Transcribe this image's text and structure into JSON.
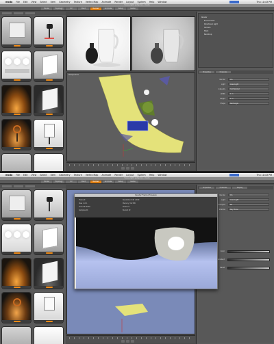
{
  "menubar": {
    "app": "modo",
    "menus": [
      "File",
      "Edit",
      "View",
      "Select",
      "Item",
      "Geometry",
      "Texture",
      "Vertex Map",
      "Animate",
      "Render",
      "Layout",
      "System",
      "Help",
      "Window"
    ],
    "clock": "Thu 10:43 PM"
  },
  "window_title": "Scene light setup.lxo - modo",
  "toolbar_tabs": [
    "Model",
    "Topology",
    "UV",
    "Paint",
    "Render",
    "Animate",
    "Setup",
    "Game"
  ],
  "active_tab_index": 4,
  "presets_panel": {
    "items": [
      {
        "icon": "studio-light-icon"
      },
      {
        "icon": "spotlight-stand-icon"
      },
      {
        "icon": "light-bulbs-icon"
      },
      {
        "icon": "softbox-icon"
      },
      {
        "icon": "amber-glow-icon"
      },
      {
        "icon": "softbox-icon"
      },
      {
        "icon": "lamp-fire-icon"
      },
      {
        "icon": "softbox-stand-icon"
      },
      {
        "icon": "grey-backdrop-icon"
      },
      {
        "icon": "white-backdrop-icon"
      }
    ]
  },
  "viewports": {
    "render_left_label": "Render",
    "render_right_label": "Preview",
    "perspective_label": "Perspective"
  },
  "item_tree": {
    "rows": [
      "Render",
      "Environment",
      "Directional Light",
      "Camera",
      "Mesh",
      "Backdrop",
      "Area Light",
      "Spot Light"
    ]
  },
  "properties": {
    "tabs": [
      "Properties",
      "Channels",
      "Display"
    ],
    "fields": [
      {
        "label": "Render",
        "value": "On"
      },
      {
        "label": "Light",
        "value": "Area Light"
      },
      {
        "label": "Intensity",
        "value": "3.0 W/srm2"
      },
      {
        "label": "Width",
        "value": "1 m"
      },
      {
        "label": "Height",
        "value": "1 m"
      },
      {
        "label": "Shape",
        "value": "Rectangle"
      },
      {
        "label": "Samples",
        "value": "64"
      },
      {
        "label": "Shadow",
        "value": "Ray Trace"
      }
    ]
  },
  "preview_window": {
    "title": "Render Frame (Preview)",
    "stats": [
      "Frame 0",
      "Pass 1 of 1",
      "Time 00:00:06",
      "Samples 64",
      "Resolution 640 x 480",
      "Memory 312 MB",
      "Passes 8",
      "Bucket 32"
    ]
  },
  "swatches": [
    {
      "label": "Color"
    },
    {
      "label": "Gradient"
    },
    {
      "label": "Falloff"
    }
  ],
  "colors": {
    "accent": "#e07f12",
    "panel": "#5a5a5a",
    "viewport": "#5e5e5e"
  }
}
